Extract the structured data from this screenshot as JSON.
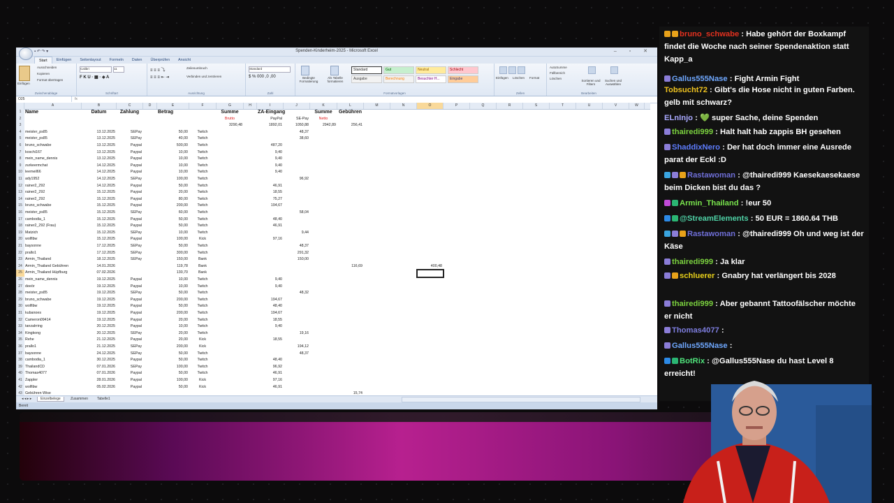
{
  "excel": {
    "title": "Spenden-Kinderheim-2025 - Microsoft Excel",
    "tabs": [
      "Start",
      "Einfügen",
      "Seitenlayout",
      "Formeln",
      "Daten",
      "Überprüfen",
      "Ansicht"
    ],
    "ribbon": {
      "clipboard": {
        "paste": "Einfügen",
        "cut": "Ausschneiden",
        "copy": "Kopieren",
        "format": "Format übertragen",
        "group": "Zwischenablage"
      },
      "font": {
        "name": "Calibri",
        "size": "11",
        "group": "Schriftart"
      },
      "alignment": {
        "wrap": "Zeilenumbruch",
        "merge": "Verbinden und zentrieren",
        "group": "Ausrichtung"
      },
      "number": {
        "format": "Standard",
        "group": "Zahl"
      },
      "styles": {
        "cond": "Bedingte Formatierung",
        "table": "Als Tabelle formatieren",
        "group": "Formatvorlagen",
        "items": [
          "Standard",
          "Gut",
          "Neutral",
          "Schlecht",
          "Ausgabe",
          "Berechnung",
          "Besuchter H...",
          "Eingabe"
        ]
      },
      "cells": {
        "insert": "Einfügen",
        "delete": "Löschen",
        "format": "Format",
        "group": "Zellen"
      },
      "editing": {
        "autosum": "AutoSumme",
        "fill": "Füllbereich",
        "clear": "Löschen",
        "sort": "Sortieren und Filtern",
        "find": "Suchen und Auswählen",
        "group": "Bearbeiten"
      }
    },
    "namebox": "O25",
    "fx": "fx",
    "columns": [
      "A",
      "B",
      "C",
      "D",
      "E",
      "F",
      "G",
      "H",
      "I",
      "J",
      "K",
      "L",
      "M",
      "N",
      "O",
      "P",
      "Q",
      "R",
      "S",
      "T",
      "U",
      "V",
      "W"
    ],
    "headers": {
      "name": "Name",
      "datum": "Datum",
      "zahlung": "Zahlung",
      "betrag": "Betrag",
      "summe": "Summe",
      "za": "ZA-Eingang",
      "summe2": "Summe",
      "gebuehren": "Gebühren"
    },
    "row2": {
      "brutto": "Brutto",
      "paypal": "PayPal",
      "sepay": "SE-Pay",
      "netto": "Netto"
    },
    "row3": {
      "g": "3290,48",
      "i": "1892,01",
      "j": "1050,88",
      "k": "2942,89",
      "l": "256,41"
    },
    "rows": [
      {
        "n": "4",
        "a": "meister_ps85",
        "b": "13.12.2025",
        "c": "SEPay",
        "e": "50,00",
        "f": "Twitch",
        "i": "",
        "j": "48,37"
      },
      {
        "n": "5",
        "a": "meister_ps85",
        "b": "13.12.2025",
        "c": "SEPay",
        "e": "40,00",
        "f": "Twitch",
        "i": "",
        "j": "38,60"
      },
      {
        "n": "6",
        "a": "bruno_schwabe",
        "b": "13.12.2025",
        "c": "Paypal",
        "e": "500,00",
        "f": "Twitch",
        "i": "487,20",
        "j": ""
      },
      {
        "n": "7",
        "a": "koschi167",
        "b": "13.12.2025",
        "c": "Paypal",
        "e": "10,00",
        "f": "Twitch",
        "i": "9,40",
        "j": ""
      },
      {
        "n": "8",
        "a": "mein_name_dennis",
        "b": "13.12.2025",
        "c": "Paypal",
        "e": "10,00",
        "f": "Twitch",
        "i": "9,40",
        "j": ""
      },
      {
        "n": "9",
        "a": "zurkeermchat",
        "b": "14.12.2025",
        "c": "Paypal",
        "e": "10,00",
        "f": "Twitch",
        "i": "9,40",
        "j": ""
      },
      {
        "n": "10",
        "a": "leemeil66",
        "b": "14.12.2025",
        "c": "Paypal",
        "e": "10,00",
        "f": "Twitch",
        "i": "9,40",
        "j": ""
      },
      {
        "n": "11",
        "a": "ady1952",
        "b": "14.12.2025",
        "c": "SEPay",
        "e": "100,00",
        "f": "Twitch",
        "i": "",
        "j": "96,92"
      },
      {
        "n": "12",
        "a": "rainer2_292",
        "b": "14.12.2025",
        "c": "Paypal",
        "e": "50,00",
        "f": "Twitch",
        "i": "46,91",
        "j": ""
      },
      {
        "n": "13",
        "a": "rainer2_292",
        "b": "15.12.2025",
        "c": "Paypal",
        "e": "20,00",
        "f": "Twitch",
        "i": "18,55",
        "j": ""
      },
      {
        "n": "14",
        "a": "rainer2_292",
        "b": "15.12.2025",
        "c": "Paypal",
        "e": "80,00",
        "f": "Twitch",
        "i": "75,27",
        "j": ""
      },
      {
        "n": "15",
        "a": "bruno_schwabe",
        "b": "15.12.2025",
        "c": "Paypal",
        "e": "200,00",
        "f": "Twitch",
        "i": "194,67",
        "j": ""
      },
      {
        "n": "16",
        "a": "meister_ps85",
        "b": "15.12.2025",
        "c": "SEPay",
        "e": "60,00",
        "f": "Twitch",
        "i": "",
        "j": "58,04"
      },
      {
        "n": "17",
        "a": "cambodia_1",
        "b": "15.12.2025",
        "c": "Paypal",
        "e": "50,00",
        "f": "Twitch",
        "i": "48,40",
        "j": ""
      },
      {
        "n": "18",
        "a": "rainer2_292 (Frau)",
        "b": "15.12.2025",
        "c": "Paypal",
        "e": "50,00",
        "f": "Twitch",
        "i": "46,91",
        "j": ""
      },
      {
        "n": "19",
        "a": "Matzich",
        "b": "15.12.2025",
        "c": "SEPay",
        "e": "10,00",
        "f": "Twitch",
        "i": "",
        "j": "9,44"
      },
      {
        "n": "20",
        "a": "wolfibw",
        "b": "15.12.2025",
        "c": "Paypal",
        "e": "100,00",
        "f": "Kick",
        "i": "97,16",
        "j": ""
      },
      {
        "n": "21",
        "a": "baysonne",
        "b": "17.12.2025",
        "c": "SEPay",
        "e": "50,00",
        "f": "Twitch",
        "i": "",
        "j": "48,37"
      },
      {
        "n": "22",
        "a": "prallo1",
        "b": "17.12.2025",
        "c": "SEPay",
        "e": "300,00",
        "f": "Twitch",
        "i": "",
        "j": "291,32"
      },
      {
        "n": "23",
        "a": "Armin_Thailand",
        "b": "18.12.2025",
        "c": "SEPay",
        "e": "150,00",
        "f": "Bank",
        "i": "",
        "j": "150,00"
      },
      {
        "n": "24",
        "a": "Armin_Thailand Gebühren",
        "b": "14.01.2026",
        "c": "",
        "e": "119,78",
        "f": "Bank",
        "i": "",
        "j": "",
        "l": "116,69",
        "o": "400,48"
      },
      {
        "n": "25",
        "a": "Armin_Thailand Hüpfburg",
        "b": "07.02.2026",
        "c": "",
        "e": "130,70",
        "f": "Bank",
        "i": "",
        "j": ""
      },
      {
        "n": "26",
        "a": "mein_name_dennis",
        "b": "19.12.2025",
        "c": "Paypal",
        "e": "10,00",
        "f": "Twitch",
        "i": "9,40",
        "j": ""
      },
      {
        "n": "27",
        "a": "deeör",
        "b": "19.12.2025",
        "c": "Paypal",
        "e": "10,00",
        "f": "Twitch",
        "i": "9,40",
        "j": ""
      },
      {
        "n": "28",
        "a": "meister_ps85",
        "b": "19.12.2025",
        "c": "SEPay",
        "e": "50,00",
        "f": "Twitch",
        "i": "",
        "j": "48,32"
      },
      {
        "n": "29",
        "a": "bruno_schwabe",
        "b": "19.12.2025",
        "c": "Paypal",
        "e": "200,00",
        "f": "Twitch",
        "i": "194,67",
        "j": ""
      },
      {
        "n": "30",
        "a": "wolfibw",
        "b": "19.12.2025",
        "c": "Paypal",
        "e": "50,00",
        "f": "Twitch",
        "i": "48,40",
        "j": ""
      },
      {
        "n": "31",
        "a": "kubanoes",
        "b": "19.12.2025",
        "c": "Paypal",
        "e": "200,00",
        "f": "Twitch",
        "i": "194,67",
        "j": ""
      },
      {
        "n": "32",
        "a": "Cameron09414",
        "b": "19.12.2025",
        "c": "Paypal",
        "e": "20,00",
        "f": "Twitch",
        "i": "18,55",
        "j": ""
      },
      {
        "n": "33",
        "a": "tanzalrring",
        "b": "20.12.2025",
        "c": "Paypal",
        "e": "10,00",
        "f": "Twitch",
        "i": "9,40",
        "j": ""
      },
      {
        "n": "34",
        "a": "Kingkong",
        "b": "20.12.2025",
        "c": "SEPay",
        "e": "20,00",
        "f": "Twitch",
        "i": "",
        "j": "19,16"
      },
      {
        "n": "35",
        "a": "Rehe",
        "b": "21.12.2025",
        "c": "Paypal",
        "e": "20,00",
        "f": "Kick",
        "i": "18,55",
        "j": ""
      },
      {
        "n": "36",
        "a": "prallo1",
        "b": "21.12.2025",
        "c": "SEPay",
        "e": "200,00",
        "f": "Kick",
        "i": "",
        "j": "194,12"
      },
      {
        "n": "37",
        "a": "baysonne",
        "b": "24.12.2025",
        "c": "SEPay",
        "e": "50,00",
        "f": "Twitch",
        "i": "",
        "j": "48,37"
      },
      {
        "n": "38",
        "a": "cambodia_1",
        "b": "30.12.2025",
        "c": "Paypal",
        "e": "50,00",
        "f": "Twitch",
        "i": "48,40",
        "j": ""
      },
      {
        "n": "39",
        "a": "ThailandCD",
        "b": "07.01.2026",
        "c": "SEPay",
        "e": "100,00",
        "f": "Twitch",
        "i": "96,92",
        "j": ""
      },
      {
        "n": "40",
        "a": "Thomas4077",
        "b": "07.01.2026",
        "c": "Paypal",
        "e": "50,00",
        "f": "Twitch",
        "i": "46,91",
        "j": ""
      },
      {
        "n": "41",
        "a": "Zappler",
        "b": "28.01.2026",
        "c": "Paypal",
        "e": "100,00",
        "f": "Kick",
        "i": "97,16",
        "j": ""
      },
      {
        "n": "42",
        "a": "wolfibw",
        "b": "05.02.2026",
        "c": "Paypal",
        "e": "50,00",
        "f": "Kick",
        "i": "46,91",
        "j": ""
      },
      {
        "n": "43",
        "a": "Gebühren Wise",
        "b": "",
        "c": "",
        "e": "",
        "f": "",
        "i": "",
        "j": "",
        "l": "15,74"
      }
    ],
    "sheets": [
      "Einzelbelege",
      "Zusammen",
      "Tabelle1"
    ],
    "status": "Bereit"
  },
  "chat": [
    {
      "user": "bruno_schwabe",
      "color": "#e4311f",
      "badges": [
        "#e8a21a",
        "#e8a21a"
      ],
      "text": "Habe gehört der Boxkampf findet die Woche nach seiner Spendenaktion statt Kapp_a"
    },
    {
      "user": "Gallus555Nase",
      "color": "#6fa8ff",
      "badges": [
        "#8b7dd8"
      ],
      "text": "Fight Armin Fight"
    },
    {
      "user": "Tobsucht72",
      "color": "#f0c420",
      "badges": [],
      "text": "Gibt's die Hose nicht in guten Farben. gelb mit schwarz?"
    },
    {
      "user": "ELnInjo",
      "color": "#a9a9ff",
      "badges": [],
      "text": "💚 super Sache, deine Spenden"
    },
    {
      "user": "thairedi999",
      "color": "#7bd13f",
      "badges": [
        "#8b7dd8"
      ],
      "text": "Halt halt hab zappis BH gesehen"
    },
    {
      "user": "ShaddixNero",
      "color": "#5e7dff",
      "badges": [
        "#8b7dd8"
      ],
      "text": "Der hat doch immer eine Ausrede parat der Eckl :D"
    },
    {
      "user": "Rastawoman",
      "color": "#6f6fd8",
      "badges": [
        "#3aa5e0",
        "#8b7dd8",
        "#e8a21a"
      ],
      "text": "@thairedi999 Kaesekaesekaese beim Dicken bist du das ?"
    },
    {
      "user": "Armin_Thailand",
      "color": "#78e24c",
      "badges": [
        "#c14bd8",
        "#2bb673"
      ],
      "text": "!eur 50"
    },
    {
      "user": "@StreamElements",
      "color": "#4fd2a6",
      "badges": [
        "#2c8ae6",
        "#2bb673"
      ],
      "text": "50 EUR = 1860.64 THB"
    },
    {
      "user": "Rastawoman",
      "color": "#6f6fd8",
      "badges": [
        "#3aa5e0",
        "#8b7dd8",
        "#e8a21a"
      ],
      "text": "@thairedi999 Oh und weg ist der Käse"
    },
    {
      "user": "thairedi999",
      "color": "#7bd13f",
      "badges": [
        "#8b7dd8"
      ],
      "text": "Ja klar"
    },
    {
      "user": "schluerer",
      "color": "#e8d01a",
      "badges": [
        "#8b7dd8",
        "#e8a21a"
      ],
      "text": "Gnabry hat verlängert bis 2028"
    },
    {
      "user": "thairedi999",
      "color": "#7bd13f",
      "badges": [
        "#8b7dd8"
      ],
      "text": "Aber gebannt Tattoofälscher möchte er nicht"
    },
    {
      "user": "Thomas4077",
      "color": "#7e7ee0",
      "badges": [
        "#8b7dd8"
      ],
      "text": ""
    },
    {
      "user": "Gallus555Nase",
      "color": "#6fa8ff",
      "badges": [
        "#8b7dd8"
      ],
      "text": ""
    },
    {
      "user": "BotRix",
      "color": "#4fe07a",
      "badges": [
        "#2c8ae6",
        "#2bb673"
      ],
      "text": "@Gallus555Nase du hast Level 8 erreicht!"
    }
  ]
}
